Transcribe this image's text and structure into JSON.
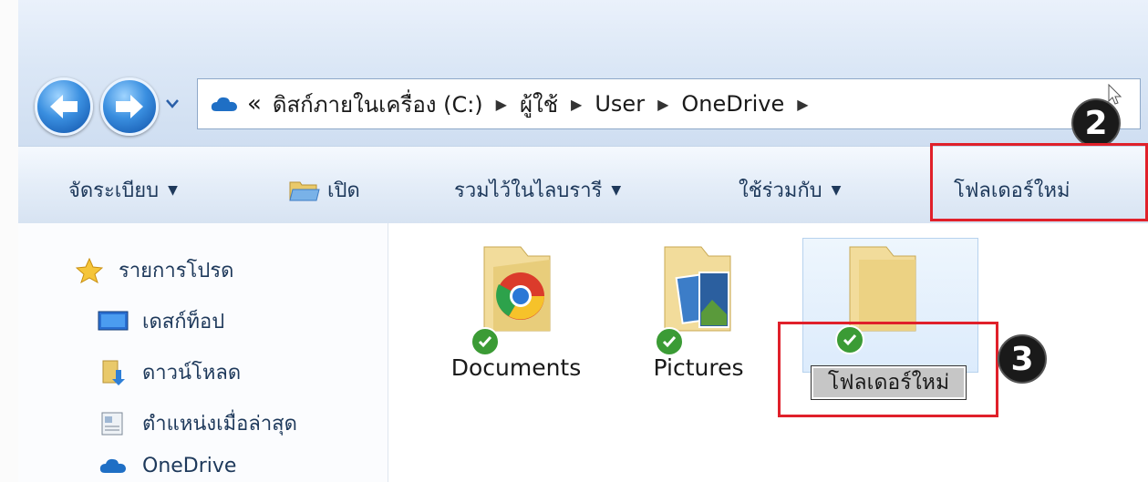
{
  "address_bar": {
    "overflow": "«",
    "crumbs": [
      "ดิสก์ภายในเครื่อง (C:)",
      "ผู้ใช้",
      "User",
      "OneDrive"
    ],
    "separator": "▶"
  },
  "toolbar": {
    "organize": "จัดระเบียบ",
    "open": "เปิด",
    "include_in_library": "รวมไว้ในไลบรารี",
    "share_with": "ใช้ร่วมกับ",
    "new_folder": "โฟลเดอร์ใหม่",
    "dropdown_glyph": "▼"
  },
  "nav_pane": {
    "items": [
      {
        "label": "รายการโปรด",
        "icon": "favorites-star-icon"
      },
      {
        "label": "เดสก์ท็อป",
        "icon": "desktop-icon"
      },
      {
        "label": "ดาวน์โหลด",
        "icon": "downloads-icon"
      },
      {
        "label": "ตำแหน่งเมื่อล่าสุด",
        "icon": "recent-places-icon"
      },
      {
        "label": "OneDrive",
        "icon": "onedrive-cloud-icon"
      }
    ]
  },
  "files": [
    {
      "name": "Documents",
      "icon": "chrome-folder-icon"
    },
    {
      "name": "Pictures",
      "icon": "pictures-folder-icon"
    },
    {
      "name": "โฟลเดอร์ใหม่",
      "icon": "new-folder-icon",
      "renaming": true
    }
  ],
  "annotations": {
    "step2": "2",
    "step3": "3",
    "highlight_color": "#e0202a"
  }
}
